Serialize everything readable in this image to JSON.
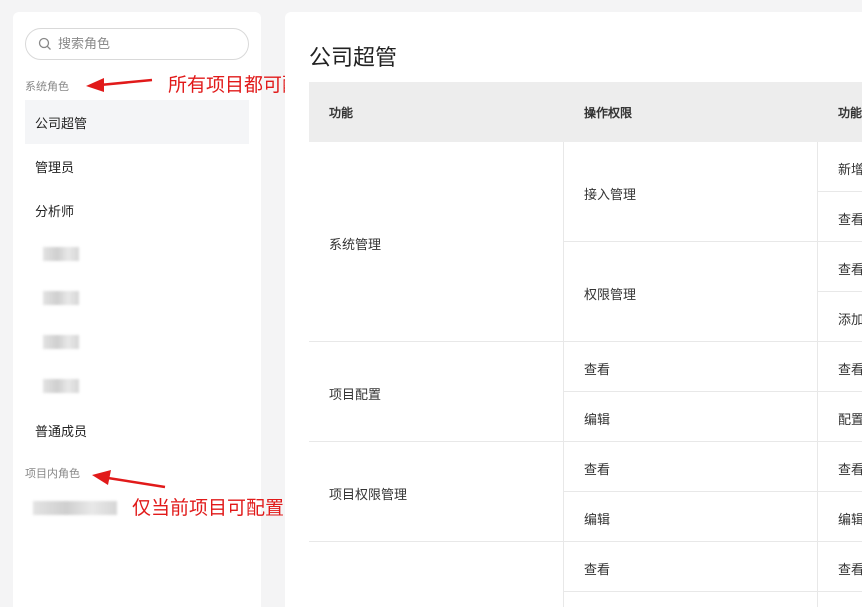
{
  "sidebar": {
    "search_placeholder": "搜索角色",
    "system_roles_label": "系统角色",
    "system_roles": [
      {
        "label": "公司超管",
        "active": true
      },
      {
        "label": "管理员"
      },
      {
        "label": "分析师"
      },
      {
        "label": "普通成员"
      }
    ],
    "project_roles_label": "项目内角色"
  },
  "annotations": {
    "system_note": "所有项目都可配置",
    "project_note": "仅当前项目可配置",
    "color": "#e11a1a"
  },
  "main": {
    "title": "公司超管",
    "columns": [
      "功能",
      "操作权限",
      "功能"
    ],
    "rows": {
      "system": {
        "feature": "系统管理",
        "groups": [
          {
            "permission": "接入管理",
            "subs": [
              "新增",
              "查看"
            ]
          },
          {
            "permission": "权限管理",
            "subs": [
              "查看",
              "添加"
            ]
          }
        ]
      },
      "project_config": {
        "feature": "项目配置",
        "items": [
          {
            "permission": "查看",
            "sub": "查看"
          },
          {
            "permission": "编辑",
            "sub": "配置"
          }
        ]
      },
      "project_perm": {
        "feature": "项目权限管理",
        "items": [
          {
            "permission": "查看",
            "sub": "查看"
          },
          {
            "permission": "编辑",
            "sub": "编辑"
          }
        ]
      },
      "last": {
        "items": [
          {
            "permission": "查看",
            "sub": "查看"
          }
        ]
      }
    }
  }
}
